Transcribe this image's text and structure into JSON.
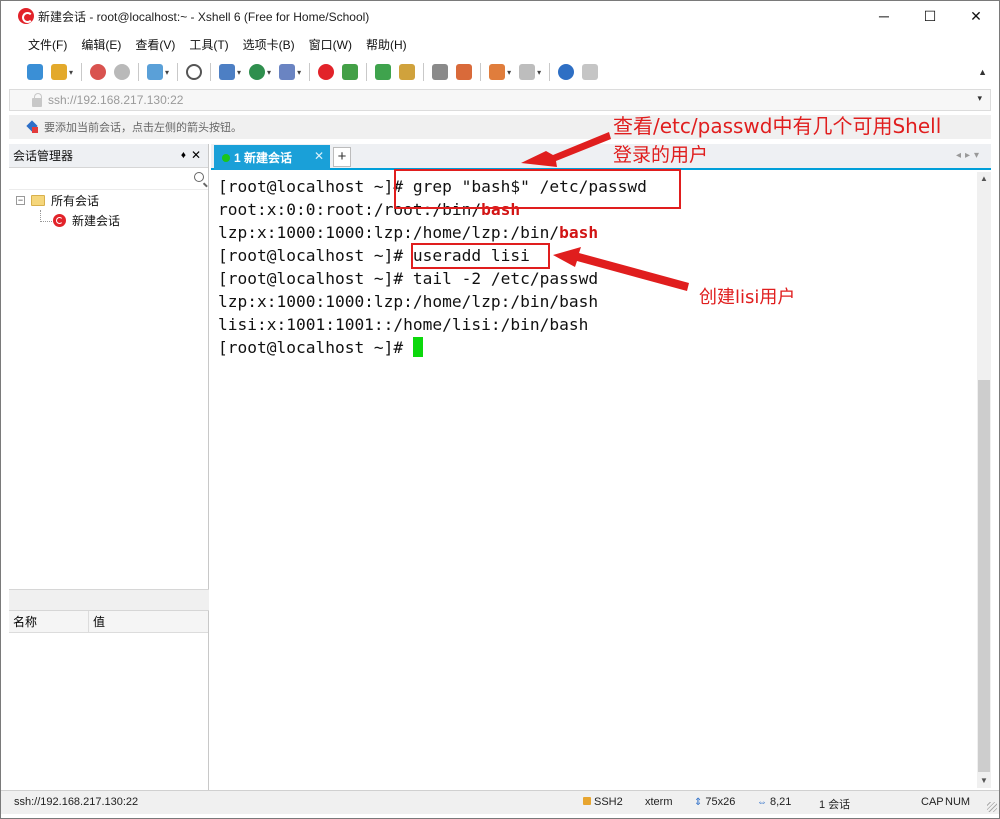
{
  "window": {
    "title": "新建会话 - root@localhost:~ - Xshell 6 (Free for Home/School)",
    "minimize": "─",
    "maximize": "☐",
    "close": "✕"
  },
  "menu": [
    "文件(F)",
    "编辑(E)",
    "查看(V)",
    "工具(T)",
    "选项卡(B)",
    "窗口(W)",
    "帮助(H)"
  ],
  "address": {
    "value": "ssh://192.168.217.130:22"
  },
  "hint": "要添加当前会话，点击左侧的箭头按钮。",
  "session_panel": {
    "title": "会话管理器",
    "pin": "♦",
    "close": "✕",
    "tree": {
      "root": "所有会话",
      "toggle": "−",
      "child": "新建会话"
    }
  },
  "props": {
    "col_name": "名称",
    "col_value": "值"
  },
  "tab": {
    "label": "1 新建会话",
    "close": "✕",
    "add": "+",
    "nav": "◂▸▾"
  },
  "terminal": {
    "lines": [
      [
        {
          "t": "[root@localhost ~]# grep \"bash$\" /etc/passwd"
        }
      ],
      [
        {
          "t": "root:x:0:0:root:/root:/bin/"
        },
        {
          "t": "bash",
          "kw": true
        }
      ],
      [
        {
          "t": "lzp:x:1000:1000:lzp:/home/lzp:/bin/"
        },
        {
          "t": "bash",
          "kw": true
        }
      ],
      [
        {
          "t": "[root@localhost ~]# useradd lisi"
        }
      ],
      [
        {
          "t": "[root@localhost ~]# tail -2 /etc/passwd"
        }
      ],
      [
        {
          "t": "lzp:x:1000:1000:lzp:/home/lzp:/bin/bash"
        }
      ],
      [
        {
          "t": "lisi:x:1001:1001::/home/lisi:/bin/bash"
        }
      ],
      [
        {
          "t": "[root@localhost ~]# "
        },
        {
          "cursor": true
        }
      ]
    ]
  },
  "annotations": {
    "note1_line1": "查看/etc/passwd中有几个可用Shell",
    "note1_line2": "登录的用户",
    "note2": "创建lisi用户",
    "color": "#e01e1e"
  },
  "status": {
    "connection": "ssh://192.168.217.130:22",
    "protocol": "SSH2",
    "terminal_type": "xterm",
    "size": "75x26",
    "cursor_pos": "8,21",
    "sessions": "1 会话",
    "caps": "CAP",
    "num": "NUM"
  },
  "colors": {
    "tab_active": "#1aa0d8",
    "keyword": "#d21414",
    "cursor": "#0cd80c"
  }
}
